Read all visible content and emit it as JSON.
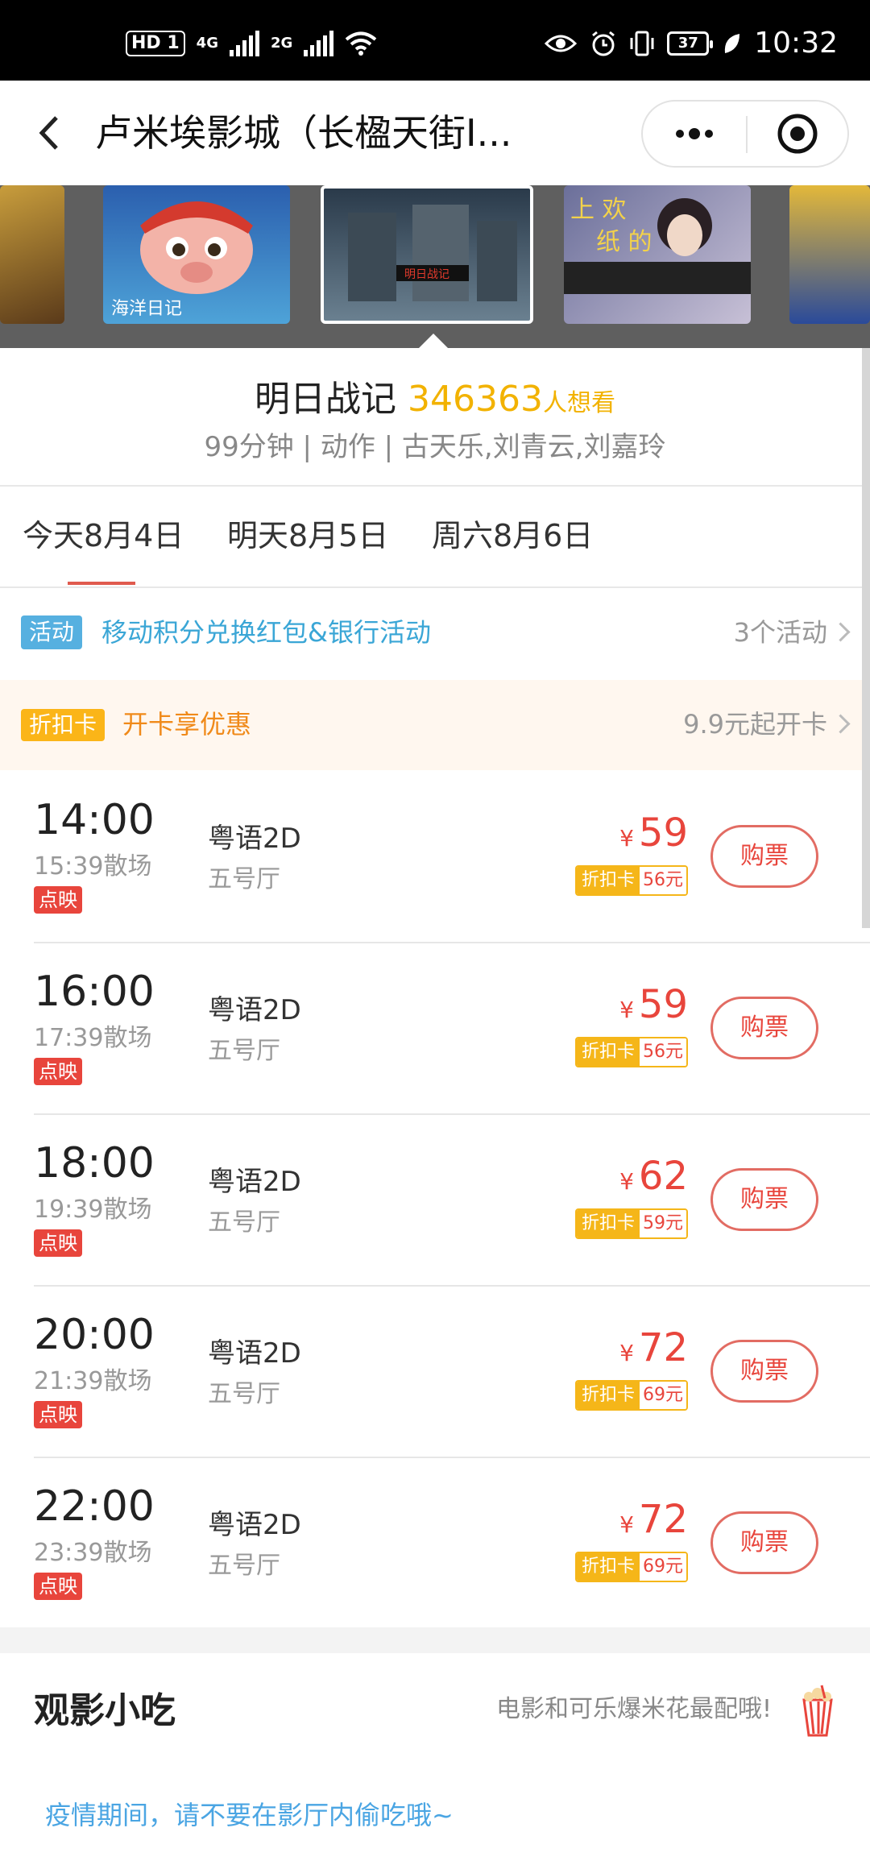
{
  "status_bar": {
    "hd_label": "HD",
    "sim_label": "1",
    "net1": "4G",
    "net2": "2G",
    "battery": "37",
    "time": "10:32"
  },
  "nav": {
    "title": "卢米埃影城（长楹天街I...",
    "back_icon": "chevron-left-icon",
    "more_icon": "more-dots-icon",
    "close_icon": "target-circle-icon"
  },
  "posters": [
    {
      "name": "poster-partial-left",
      "text": ""
    },
    {
      "name": "poster-haiyang-riji",
      "text": "海洋日记"
    },
    {
      "name": "poster-mingri-zhanji",
      "text": "明日战记"
    },
    {
      "name": "poster-xihuan-shang",
      "text": "上欢的纸巾人"
    },
    {
      "name": "poster-partial-right",
      "text": ""
    }
  ],
  "movie": {
    "title": "明日战记",
    "want_count": "346363",
    "want_suffix": "人想看",
    "meta": "99分钟 | 动作 | 古天乐,刘青云,刘嘉玲"
  },
  "dates": [
    {
      "label": "今天8月4日",
      "active": true
    },
    {
      "label": "明天8月5日",
      "active": false
    },
    {
      "label": "周六8月6日",
      "active": false
    }
  ],
  "activity": {
    "tag": "活动",
    "text": "移动积分兑换红包&银行活动",
    "right": "3个活动"
  },
  "discount_card": {
    "tag": "折扣卡",
    "text": "开卡享优惠",
    "right": "9.9元起开卡"
  },
  "showtimes": [
    {
      "start": "14:00",
      "end": "15:39散场",
      "badge": "点映",
      "lang": "粤语2D",
      "hall": "五号厅",
      "price": "59",
      "card_label": "折扣卡",
      "card_price": "56元",
      "buy": "购票"
    },
    {
      "start": "16:00",
      "end": "17:39散场",
      "badge": "点映",
      "lang": "粤语2D",
      "hall": "五号厅",
      "price": "59",
      "card_label": "折扣卡",
      "card_price": "56元",
      "buy": "购票"
    },
    {
      "start": "18:00",
      "end": "19:39散场",
      "badge": "点映",
      "lang": "粤语2D",
      "hall": "五号厅",
      "price": "62",
      "card_label": "折扣卡",
      "card_price": "59元",
      "buy": "购票"
    },
    {
      "start": "20:00",
      "end": "21:39散场",
      "badge": "点映",
      "lang": "粤语2D",
      "hall": "五号厅",
      "price": "72",
      "card_label": "折扣卡",
      "card_price": "69元",
      "buy": "购票"
    },
    {
      "start": "22:00",
      "end": "23:39散场",
      "badge": "点映",
      "lang": "粤语2D",
      "hall": "五号厅",
      "price": "72",
      "card_label": "折扣卡",
      "card_price": "69元",
      "buy": "购票"
    }
  ],
  "currency_symbol": "¥",
  "snacks": {
    "title": "观影小吃",
    "slogan": "电影和可乐爆米花最配哦!",
    "notice": "疫情期间，请不要在影厅内偷吃哦~"
  },
  "colors": {
    "accent_red": "#e8453c",
    "want_yellow": "#f2b200",
    "activity_blue": "#3aa6d6",
    "card_orange": "#f08a1a"
  }
}
